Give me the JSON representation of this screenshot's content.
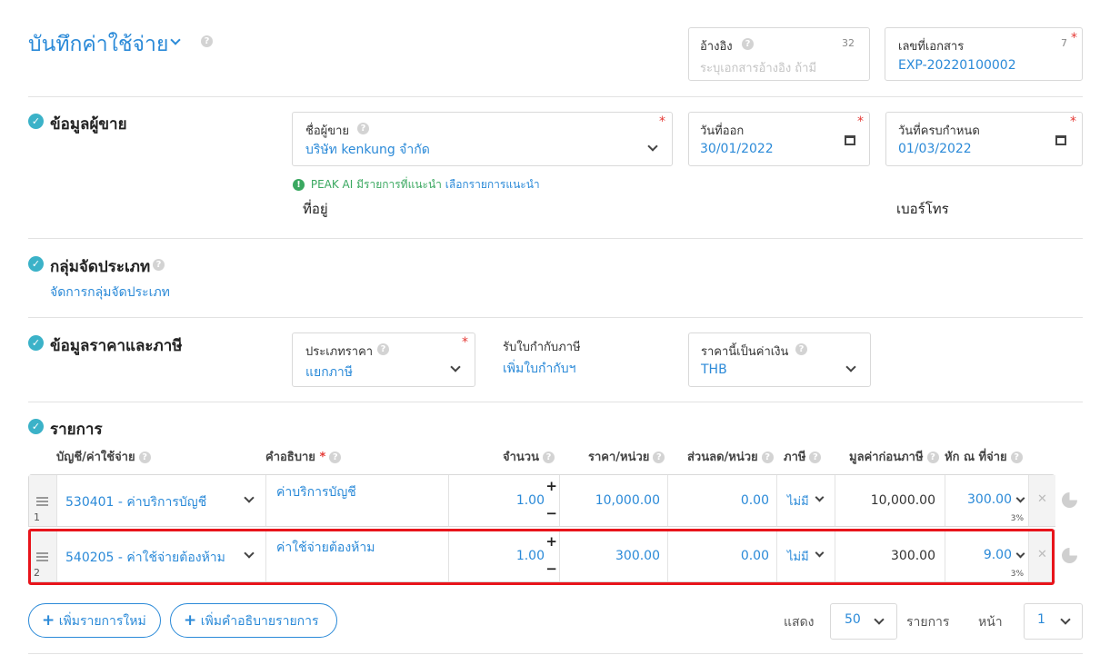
{
  "header": {
    "title": "บันทึกค่าใช้จ่าย"
  },
  "reference": {
    "label": "อ้างอิง",
    "counter": "32",
    "placeholder": "ระบุเอกสารอ้างอิง ถ้ามี"
  },
  "doc_number": {
    "label": "เลขที่เอกสาร",
    "counter": "7",
    "value": "EXP-20220100002"
  },
  "vendor_section": {
    "title": "ข้อมูลผู้ขาย",
    "vendor_label": "ชื่อผู้ขาย",
    "vendor_value": "บริษัท kenkung จำกัด",
    "issue_date_label": "วันที่ออก",
    "issue_date_value": "30/01/2022",
    "due_date_label": "วันที่ครบกำหนด",
    "due_date_value": "01/03/2022",
    "ai_hint_prefix": "PEAK AI มีรายการที่แนะนำ",
    "ai_hint_link": "เลือกรายการแนะนำ",
    "address_label": "ที่อยู่",
    "phone_label": "เบอร์โทร"
  },
  "category_section": {
    "title": "กลุ่มจัดประเภท",
    "manage_link": "จัดการกลุ่มจัดประเภท"
  },
  "price_section": {
    "title": "ข้อมูลราคาและภาษี",
    "price_type_label": "ประเภทราคา",
    "price_type_value": "แยกภาษี",
    "tax_invoice_label": "รับใบกำกับภาษี",
    "tax_invoice_link": "เพิ่มใบกำกับฯ",
    "currency_label": "ราคานี้เป็นค่าเงิน",
    "currency_value": "THB"
  },
  "items_section": {
    "title": "รายการ",
    "columns": {
      "account": "บัญชี/ค่าใช้จ่าย",
      "description": "คำอธิบาย",
      "quantity": "จำนวน",
      "unit_price": "ราคา/หน่วย",
      "discount": "ส่วนลด/หน่วย",
      "tax": "ภาษี",
      "pre_tax": "มูลค่าก่อนภาษี",
      "withholding": "หัก ณ ที่จ่าย"
    },
    "rows": [
      {
        "index": "1",
        "account": "530401 - ค่าบริการบัญชี",
        "description": "ค่าบริการบัญชี",
        "quantity": "1.00",
        "unit_price": "10,000.00",
        "discount": "0.00",
        "tax": "ไม่มี",
        "pre_tax": "10,000.00",
        "withholding": "300.00",
        "withholding_rate": "3%"
      },
      {
        "index": "2",
        "account": "540205 - ค่าใช้จ่ายต้องห้าม",
        "description": "ค่าใช้จ่ายต้องห้าม",
        "quantity": "1.00",
        "unit_price": "300.00",
        "discount": "0.00",
        "tax": "ไม่มี",
        "pre_tax": "300.00",
        "withholding": "9.00",
        "withholding_rate": "3%"
      }
    ],
    "add_item_button": "เพิ่มรายการใหม่",
    "add_desc_button": "เพิ่มคำอธิบายรายการ",
    "pagination": {
      "show_label": "แสดง",
      "page_size": "50",
      "items_label": "รายการ",
      "page_label": "หน้า",
      "page": "1"
    }
  },
  "colors": {
    "accent": "#2b8ad8",
    "check": "#3bb2c8",
    "highlight": "#e8141b",
    "required": "#e53935"
  }
}
